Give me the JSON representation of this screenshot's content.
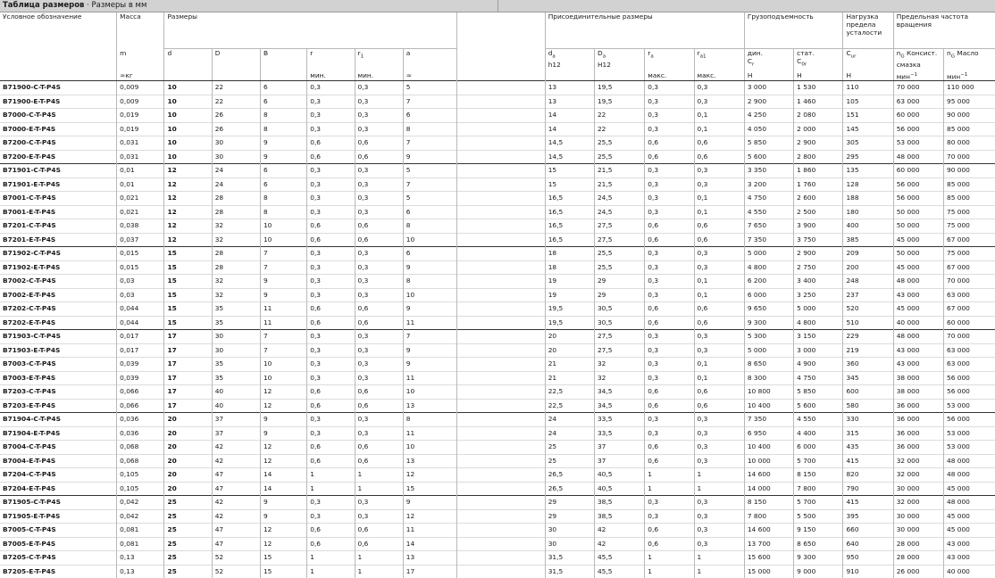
{
  "title": {
    "bold": "Таблица размеров",
    "rest": " · Размеры в мм"
  },
  "headers": {
    "designation": "Условное обозначение",
    "mass": "Масса",
    "mass_sym": "m",
    "mass_unit": "≈кг",
    "dimensions": "Размеры",
    "d": "d",
    "D": "D",
    "B": "B",
    "r": "r",
    "r_min": "мин.",
    "r1": "r",
    "r1_sub": "1",
    "r1_min": "мин.",
    "a": "a",
    "a_unit": "≈",
    "mounting": "Присоединительные размеры",
    "da": "d",
    "da_sub": "a",
    "da_tol": "h12",
    "Da": "D",
    "Da_sub": "a",
    "Da_tol": "H12",
    "ra": "r",
    "ra_sub": "a",
    "ra_max": "макс.",
    "ra1": "r",
    "ra1_sub": "a1",
    "ra1_max": "макс.",
    "load": "Грузоподъемность",
    "dyn": "дин.",
    "Cr": "C",
    "Cr_sub": "r",
    "Cr_unit": "Н",
    "stat": "стат.",
    "C0r": "C",
    "C0r_sub": "0r",
    "C0r_unit": "Н",
    "fatigue": "Нагрузка предела усталости",
    "Cur": "C",
    "Cur_sub": "ur",
    "Cur_unit": "Н",
    "speed": "Предельная частота вращения",
    "nG": "n",
    "nG_sub": "G",
    "grease": "Консист. смазка",
    "oil": "Масло",
    "speed_unit": "мин",
    "speed_unit_sup": "−1"
  },
  "groups": [
    {
      "rows": [
        [
          "B71900-C-T-P4S",
          "0,009",
          "10",
          "22",
          "6",
          "0,3",
          "0,3",
          "5",
          "13",
          "19,5",
          "0,3",
          "0,3",
          "3 000",
          "1 530",
          "110",
          "70 000",
          "110 000"
        ],
        [
          "B71900-E-T-P4S",
          "0,009",
          "10",
          "22",
          "6",
          "0,3",
          "0,3",
          "7",
          "13",
          "19,5",
          "0,3",
          "0,3",
          "2 900",
          "1 460",
          "105",
          "63 000",
          "95 000"
        ],
        [
          "B7000-C-T-P4S",
          "0,019",
          "10",
          "26",
          "8",
          "0,3",
          "0,3",
          "6",
          "14",
          "22",
          "0,3",
          "0,1",
          "4 250",
          "2 080",
          "151",
          "60 000",
          "90 000"
        ],
        [
          "B7000-E-T-P4S",
          "0,019",
          "10",
          "26",
          "8",
          "0,3",
          "0,3",
          "8",
          "14",
          "22",
          "0,3",
          "0,1",
          "4 050",
          "2 000",
          "145",
          "56 000",
          "85 000"
        ],
        [
          "B7200-C-T-P4S",
          "0,031",
          "10",
          "30",
          "9",
          "0,6",
          "0,6",
          "7",
          "14,5",
          "25,5",
          "0,6",
          "0,6",
          "5 850",
          "2 900",
          "305",
          "53 000",
          "80 000"
        ],
        [
          "B7200-E-T-P4S",
          "0,031",
          "10",
          "30",
          "9",
          "0,6",
          "0,6",
          "9",
          "14,5",
          "25,5",
          "0,6",
          "0,6",
          "5 600",
          "2 800",
          "295",
          "48 000",
          "70 000"
        ]
      ]
    },
    {
      "rows": [
        [
          "B71901-C-T-P4S",
          "0,01",
          "12",
          "24",
          "6",
          "0,3",
          "0,3",
          "5",
          "15",
          "21,5",
          "0,3",
          "0,3",
          "3 350",
          "1 860",
          "135",
          "60 000",
          "90 000"
        ],
        [
          "B71901-E-T-P4S",
          "0,01",
          "12",
          "24",
          "6",
          "0,3",
          "0,3",
          "7",
          "15",
          "21,5",
          "0,3",
          "0,3",
          "3 200",
          "1 760",
          "128",
          "56 000",
          "85 000"
        ],
        [
          "B7001-C-T-P4S",
          "0,021",
          "12",
          "28",
          "8",
          "0,3",
          "0,3",
          "5",
          "16,5",
          "24,5",
          "0,3",
          "0,1",
          "4 750",
          "2 600",
          "188",
          "56 000",
          "85 000"
        ],
        [
          "B7001-E-T-P4S",
          "0,021",
          "12",
          "28",
          "8",
          "0,3",
          "0,3",
          "6",
          "16,5",
          "24,5",
          "0,3",
          "0,1",
          "4 550",
          "2 500",
          "180",
          "50 000",
          "75 000"
        ],
        [
          "B7201-C-T-P4S",
          "0,038",
          "12",
          "32",
          "10",
          "0,6",
          "0,6",
          "8",
          "16,5",
          "27,5",
          "0,6",
          "0,6",
          "7 650",
          "3 900",
          "400",
          "50 000",
          "75 000"
        ],
        [
          "B7201-E-T-P4S",
          "0,037",
          "12",
          "32",
          "10",
          "0,6",
          "0,6",
          "10",
          "16,5",
          "27,5",
          "0,6",
          "0,6",
          "7 350",
          "3 750",
          "385",
          "45 000",
          "67 000"
        ]
      ]
    },
    {
      "rows": [
        [
          "B71902-C-T-P4S",
          "0,015",
          "15",
          "28",
          "7",
          "0,3",
          "0,3",
          "6",
          "18",
          "25,5",
          "0,3",
          "0,3",
          "5 000",
          "2 900",
          "209",
          "50 000",
          "75 000"
        ],
        [
          "B71902-E-T-P4S",
          "0,015",
          "15",
          "28",
          "7",
          "0,3",
          "0,3",
          "9",
          "18",
          "25,5",
          "0,3",
          "0,3",
          "4 800",
          "2 750",
          "200",
          "45 000",
          "67 000"
        ],
        [
          "B7002-C-T-P4S",
          "0,03",
          "15",
          "32",
          "9",
          "0,3",
          "0,3",
          "8",
          "19",
          "29",
          "0,3",
          "0,1",
          "6 200",
          "3 400",
          "248",
          "48 000",
          "70 000"
        ],
        [
          "B7002-E-T-P4S",
          "0,03",
          "15",
          "32",
          "9",
          "0,3",
          "0,3",
          "10",
          "19",
          "29",
          "0,3",
          "0,1",
          "6 000",
          "3 250",
          "237",
          "43 000",
          "63 000"
        ],
        [
          "B7202-C-T-P4S",
          "0,044",
          "15",
          "35",
          "11",
          "0,6",
          "0,6",
          "9",
          "19,5",
          "30,5",
          "0,6",
          "0,6",
          "9 650",
          "5 000",
          "520",
          "45 000",
          "67 000"
        ],
        [
          "B7202-E-T-P4S",
          "0,044",
          "15",
          "35",
          "11",
          "0,6",
          "0,6",
          "11",
          "19,5",
          "30,5",
          "0,6",
          "0,6",
          "9 300",
          "4 800",
          "510",
          "40 000",
          "60 000"
        ]
      ]
    },
    {
      "rows": [
        [
          "B71903-C-T-P4S",
          "0,017",
          "17",
          "30",
          "7",
          "0,3",
          "0,3",
          "7",
          "20",
          "27,5",
          "0,3",
          "0,3",
          "5 300",
          "3 150",
          "229",
          "48 000",
          "70 000"
        ],
        [
          "B71903-E-T-P4S",
          "0,017",
          "17",
          "30",
          "7",
          "0,3",
          "0,3",
          "9",
          "20",
          "27,5",
          "0,3",
          "0,3",
          "5 000",
          "3 000",
          "219",
          "43 000",
          "63 000"
        ],
        [
          "B7003-C-T-P4S",
          "0,039",
          "17",
          "35",
          "10",
          "0,3",
          "0,3",
          "9",
          "21",
          "32",
          "0,3",
          "0,1",
          "8 650",
          "4 900",
          "360",
          "43 000",
          "63 000"
        ],
        [
          "B7003-E-T-P4S",
          "0,039",
          "17",
          "35",
          "10",
          "0,3",
          "0,3",
          "11",
          "21",
          "32",
          "0,3",
          "0,1",
          "8 300",
          "4 750",
          "345",
          "38 000",
          "56 000"
        ],
        [
          "B7203-C-T-P4S",
          "0,066",
          "17",
          "40",
          "12",
          "0,6",
          "0,6",
          "10",
          "22,5",
          "34,5",
          "0,6",
          "0,6",
          "10 800",
          "5 850",
          "600",
          "38 000",
          "56 000"
        ],
        [
          "B7203-E-T-P4S",
          "0,066",
          "17",
          "40",
          "12",
          "0,6",
          "0,6",
          "13",
          "22,5",
          "34,5",
          "0,6",
          "0,6",
          "10 400",
          "5 600",
          "580",
          "36 000",
          "53 000"
        ]
      ]
    },
    {
      "rows": [
        [
          "B71904-C-T-P4S",
          "0,036",
          "20",
          "37",
          "9",
          "0,3",
          "0,3",
          "8",
          "24",
          "33,5",
          "0,3",
          "0,3",
          "7 350",
          "4 550",
          "330",
          "36 000",
          "56 000"
        ],
        [
          "B71904-E-T-P4S",
          "0,036",
          "20",
          "37",
          "9",
          "0,3",
          "0,3",
          "11",
          "24",
          "33,5",
          "0,3",
          "0,3",
          "6 950",
          "4 400",
          "315",
          "36 000",
          "53 000"
        ],
        [
          "B7004-C-T-P4S",
          "0,068",
          "20",
          "42",
          "12",
          "0,6",
          "0,6",
          "10",
          "25",
          "37",
          "0,6",
          "0,3",
          "10 400",
          "6 000",
          "435",
          "36 000",
          "53 000"
        ],
        [
          "B7004-E-T-P4S",
          "0,068",
          "20",
          "42",
          "12",
          "0,6",
          "0,6",
          "13",
          "25",
          "37",
          "0,6",
          "0,3",
          "10 000",
          "5 700",
          "415",
          "32 000",
          "48 000"
        ],
        [
          "B7204-C-T-P4S",
          "0,105",
          "20",
          "47",
          "14",
          "1",
          "1",
          "12",
          "26,5",
          "40,5",
          "1",
          "1",
          "14 600",
          "8 150",
          "820",
          "32 000",
          "48 000"
        ],
        [
          "B7204-E-T-P4S",
          "0,105",
          "20",
          "47",
          "14",
          "1",
          "1",
          "15",
          "26,5",
          "40,5",
          "1",
          "1",
          "14 000",
          "7 800",
          "790",
          "30 000",
          "45 000"
        ]
      ]
    },
    {
      "rows": [
        [
          "B71905-C-T-P4S",
          "0,042",
          "25",
          "42",
          "9",
          "0,3",
          "0,3",
          "9",
          "29",
          "38,5",
          "0,3",
          "0,3",
          "8 150",
          "5 700",
          "415",
          "32 000",
          "48 000"
        ],
        [
          "B71905-E-T-P4S",
          "0,042",
          "25",
          "42",
          "9",
          "0,3",
          "0,3",
          "12",
          "29",
          "38,5",
          "0,3",
          "0,3",
          "7 800",
          "5 500",
          "395",
          "30 000",
          "45 000"
        ],
        [
          "B7005-C-T-P4S",
          "0,081",
          "25",
          "47",
          "12",
          "0,6",
          "0,6",
          "11",
          "30",
          "42",
          "0,6",
          "0,3",
          "14 600",
          "9 150",
          "660",
          "30 000",
          "45 000"
        ],
        [
          "B7005-E-T-P4S",
          "0,081",
          "25",
          "47",
          "12",
          "0,6",
          "0,6",
          "14",
          "30",
          "42",
          "0,6",
          "0,3",
          "13 700",
          "8 650",
          "640",
          "28 000",
          "43 000"
        ],
        [
          "B7205-C-T-P4S",
          "0,13",
          "25",
          "52",
          "15",
          "1",
          "1",
          "13",
          "31,5",
          "45,5",
          "1",
          "1",
          "15 600",
          "9 300",
          "950",
          "28 000",
          "43 000"
        ],
        [
          "B7205-E-T-P4S",
          "0,13",
          "25",
          "52",
          "15",
          "1",
          "1",
          "17",
          "31,5",
          "45,5",
          "1",
          "1",
          "15 000",
          "9 000",
          "910",
          "26 000",
          "40 000"
        ]
      ]
    }
  ]
}
